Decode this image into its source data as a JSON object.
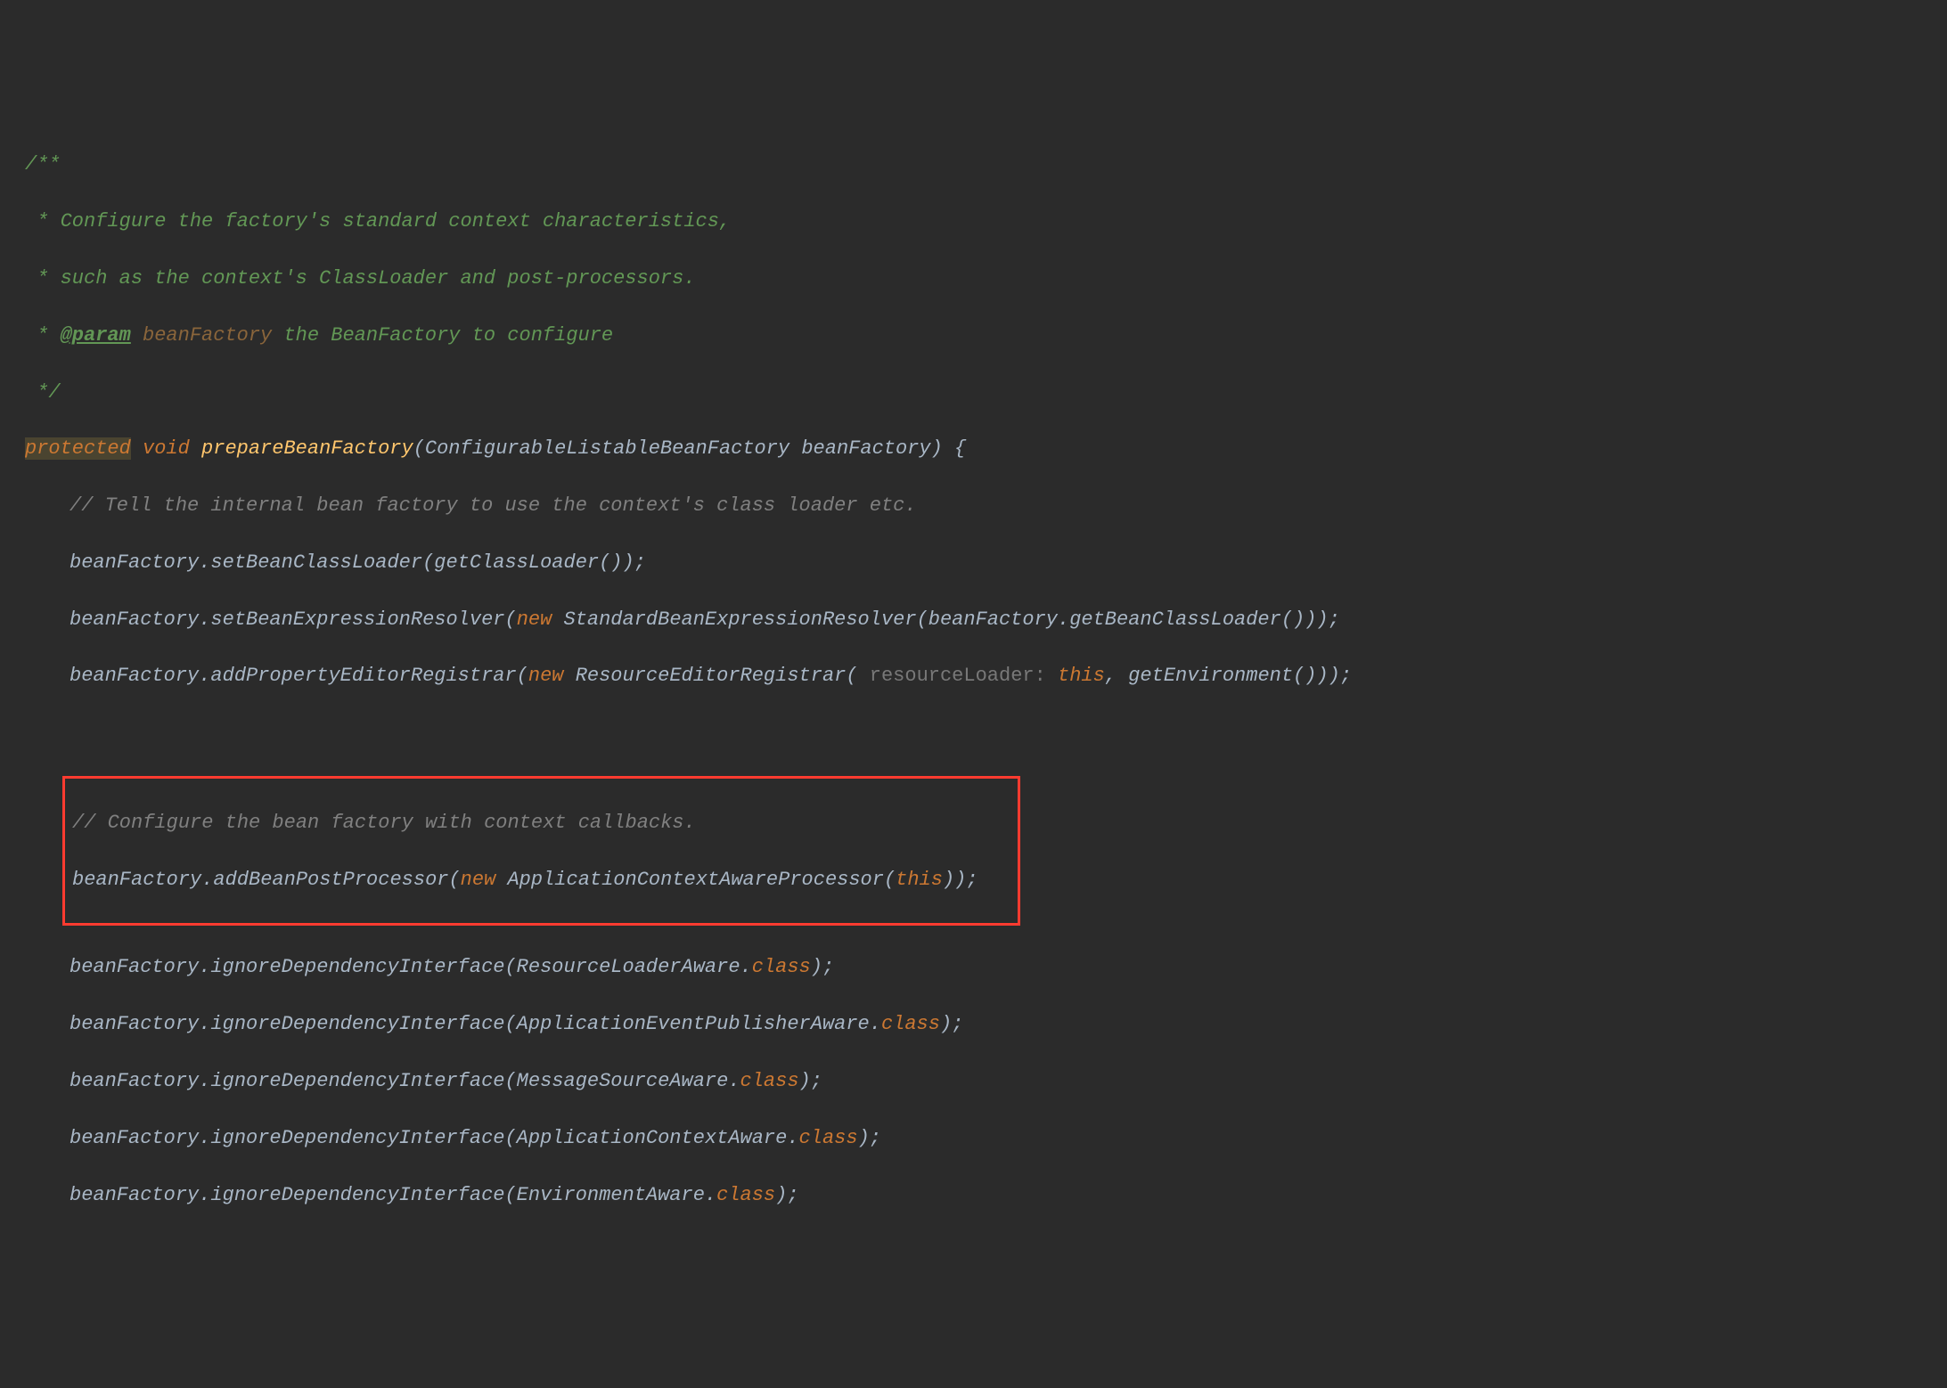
{
  "javadoc": {
    "open": "/**",
    "l1": " * Configure the factory's standard context characteristics,",
    "l2": " * such as the context's ClassLoader and post-processors.",
    "paramPrefix": " * ",
    "paramTag": "@param",
    "paramName": " beanFactory",
    "paramDesc": " the BeanFactory to configure",
    "close": " */"
  },
  "sig": {
    "protected": "protected",
    "void": " void ",
    "method": "prepareBeanFactory",
    "params": "(ConfigurableListableBeanFactory beanFactory) {"
  },
  "c1": "// Tell the internal bean factory to use the context's class loader etc.",
  "l1": "beanFactory.setBeanClassLoader(getClassLoader());",
  "l2a": "beanFactory.setBeanExpressionResolver(",
  "new": "new",
  "l2b": " StandardBeanExpressionResolver(beanFactory.getBeanClassLoader()));",
  "l3a": "beanFactory.addPropertyEditorRegistrar(",
  "l3b": " ResourceEditorRegistrar(",
  "inlay": " resourceLoader: ",
  "this": "this",
  "l3c": ", getEnvironment()));",
  "c2": "// Configure the bean factory with context callbacks.",
  "l4a": "beanFactory.addBeanPostProcessor(",
  "l4b": " ApplicationContextAwareProcessor(",
  "l4c": "));",
  "l5a": "beanFactory.ignoreDependencyInterface(ResourceLoaderAware.",
  "class": "class",
  "end": ");",
  "l6a": "beanFactory.ignoreDependencyInterface(ApplicationEventPublisherAware.",
  "l7a": "beanFactory.ignoreDependencyInterface(MessageSourceAware.",
  "l8a": "beanFactory.ignoreDependencyInterface(ApplicationContextAware.",
  "l9a": "beanFactory.ignoreDependencyInterface(EnvironmentAware."
}
